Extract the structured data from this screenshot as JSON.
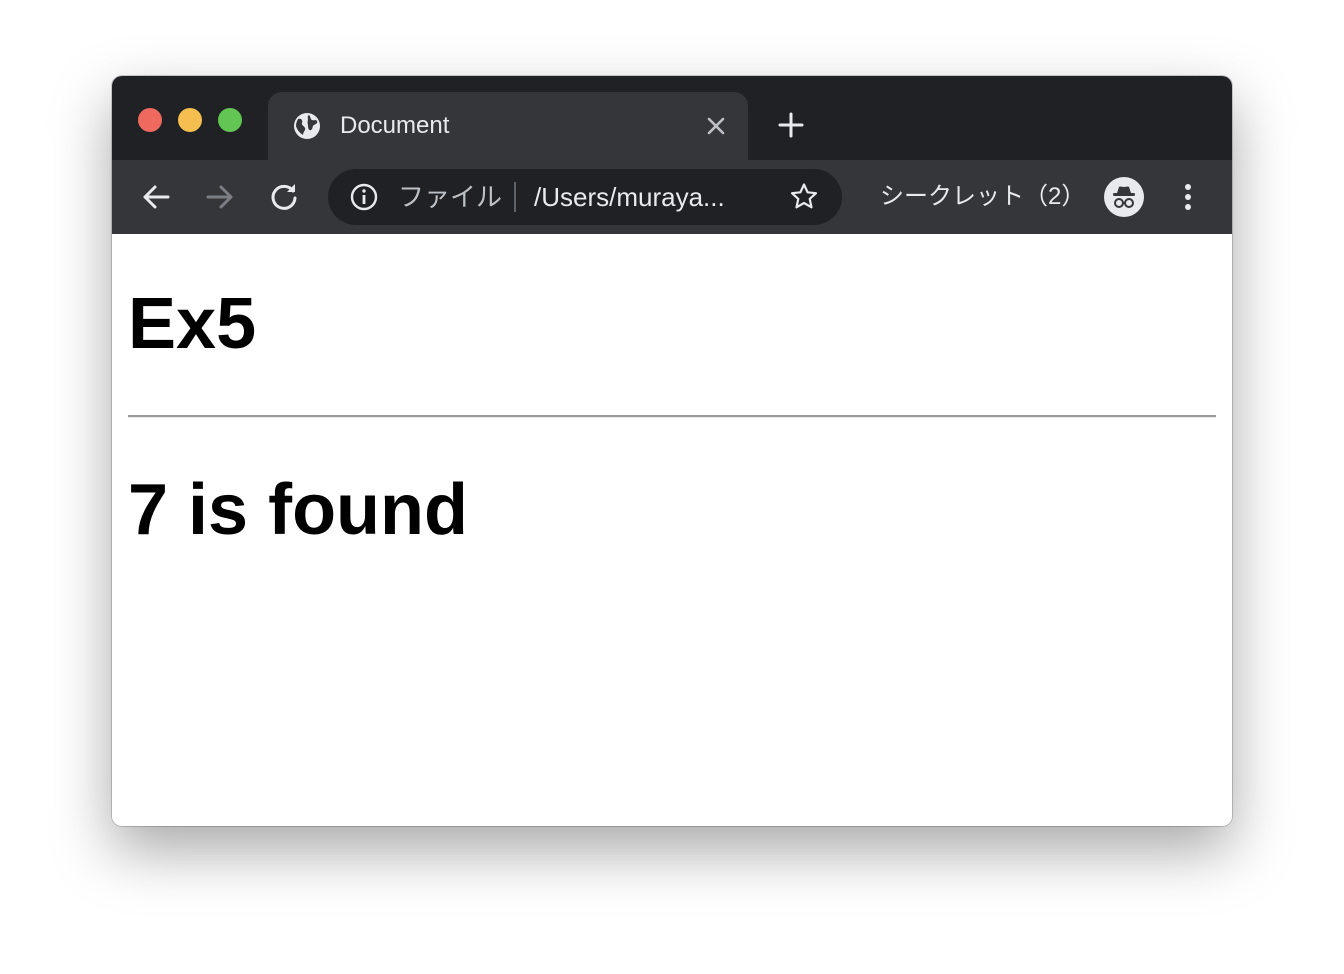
{
  "window": {
    "traffic_colors": {
      "close": "#ee6a5f",
      "minimize": "#f5bf4f",
      "maximize": "#62c554"
    }
  },
  "tab": {
    "title": "Document",
    "favicon": "globe-icon",
    "close_icon": "close-icon"
  },
  "new_tab_icon": "plus-icon",
  "toolbar": {
    "back_icon": "arrow-left-icon",
    "forward_icon": "arrow-right-icon",
    "reload_icon": "reload-icon",
    "omnibox": {
      "info_icon": "info-icon",
      "scheme_label": "ファイル",
      "url": "/Users/muraya...",
      "star_icon": "star-icon"
    },
    "incognito_label": "シークレット（2）",
    "incognito_icon": "incognito-icon",
    "menu_icon": "more-vert-icon"
  },
  "page": {
    "heading": "Ex5",
    "result": "7 is found"
  }
}
